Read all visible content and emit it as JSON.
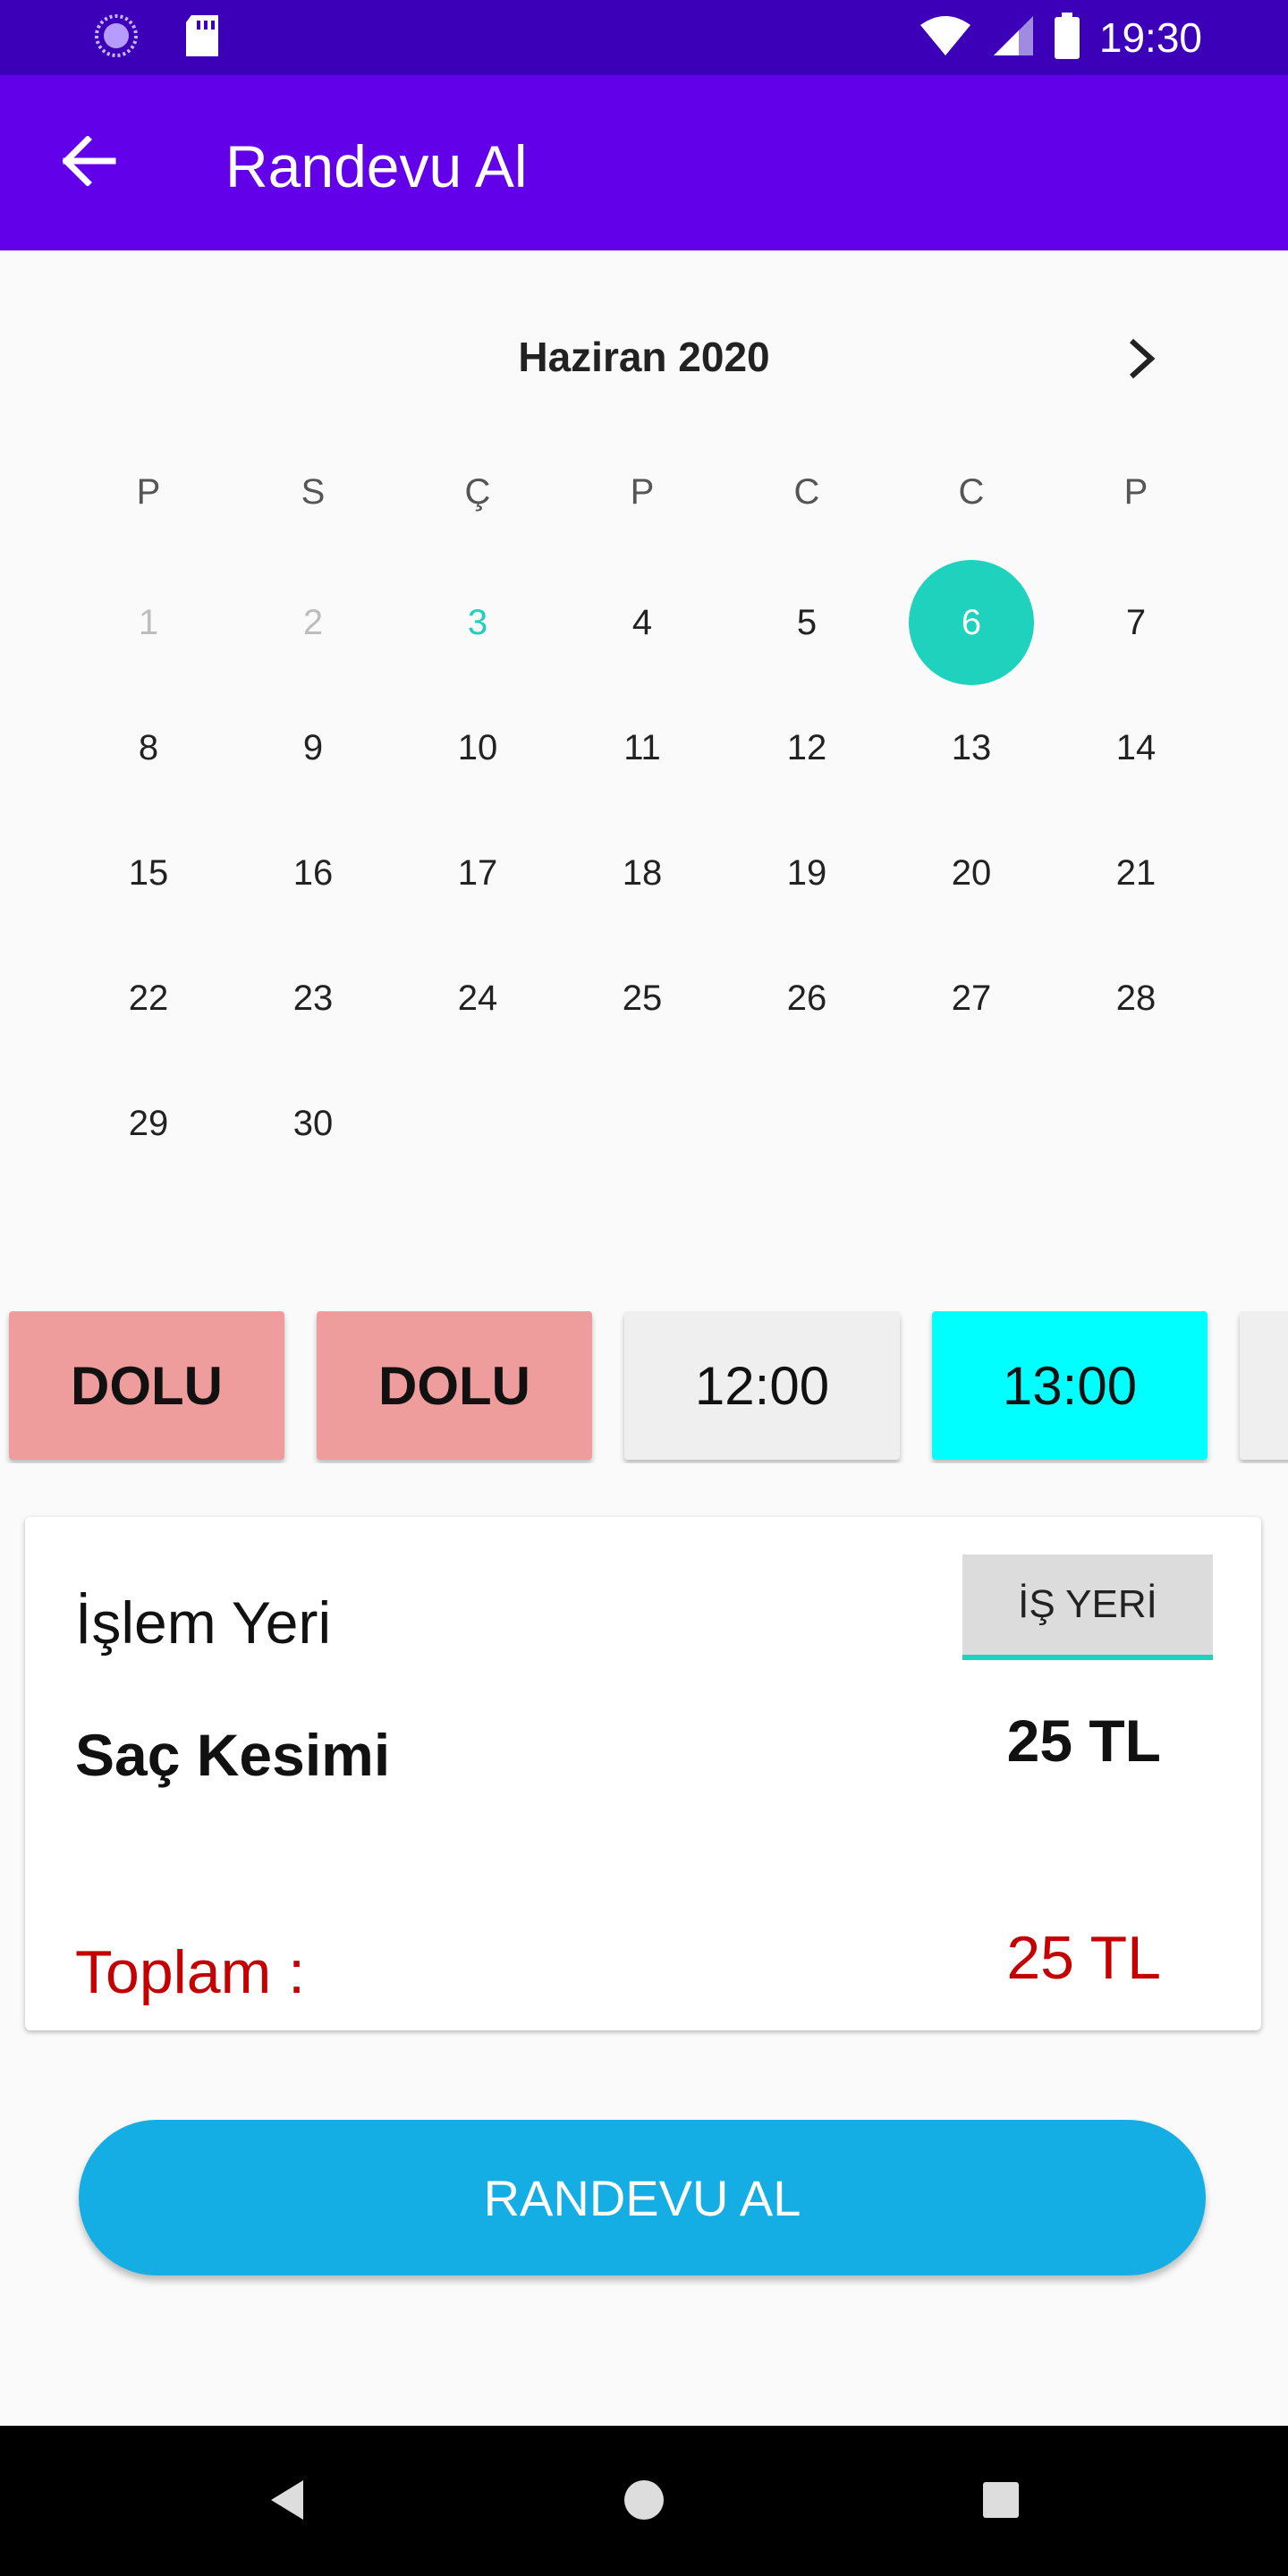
{
  "status_bar": {
    "time": "19:30",
    "left_icons": [
      "activity-icon",
      "sd-card-icon"
    ],
    "right_icons": [
      "wifi-icon",
      "signal-icon",
      "battery-icon"
    ]
  },
  "app_bar": {
    "title": "Randevu Al",
    "back_icon": "arrow-back-icon",
    "color": "#6200ea",
    "status_color": "#3b00b8"
  },
  "calendar": {
    "month": "Haziran 2020",
    "next_icon": "chevron-right-icon",
    "weekdays": [
      "P",
      "S",
      "Ç",
      "P",
      "C",
      "C",
      "P"
    ],
    "days": [
      {
        "n": "1",
        "state": "disabled"
      },
      {
        "n": "2",
        "state": "disabled"
      },
      {
        "n": "3",
        "state": "today"
      },
      {
        "n": "4"
      },
      {
        "n": "5"
      },
      {
        "n": "6",
        "state": "selected"
      },
      {
        "n": "7"
      },
      {
        "n": "8"
      },
      {
        "n": "9"
      },
      {
        "n": "10"
      },
      {
        "n": "11"
      },
      {
        "n": "12"
      },
      {
        "n": "13"
      },
      {
        "n": "14"
      },
      {
        "n": "15"
      },
      {
        "n": "16"
      },
      {
        "n": "17"
      },
      {
        "n": "18"
      },
      {
        "n": "19"
      },
      {
        "n": "20"
      },
      {
        "n": "21"
      },
      {
        "n": "22"
      },
      {
        "n": "23"
      },
      {
        "n": "24"
      },
      {
        "n": "25"
      },
      {
        "n": "26"
      },
      {
        "n": "27"
      },
      {
        "n": "28"
      },
      {
        "n": "29"
      },
      {
        "n": "30"
      }
    ],
    "accent_color": "#1fd2be"
  },
  "time_slots": [
    {
      "label": "DOLU",
      "state": "full"
    },
    {
      "label": "DOLU",
      "state": "full"
    },
    {
      "label": "12:00",
      "state": "free"
    },
    {
      "label": "13:00",
      "state": "selected"
    },
    {
      "label": "",
      "state": "free"
    }
  ],
  "summary": {
    "place_label": "İşlem Yeri",
    "place_button": "İŞ YERİ",
    "service_name": "Saç Kesimi",
    "service_price": "25 TL",
    "total_label": "Toplam :",
    "total_value": "25 TL",
    "total_color": "#c40000"
  },
  "action": {
    "label": "RANDEVU AL",
    "color": "#14aee5"
  },
  "nav_bar": {
    "icons": [
      "nav-back-icon",
      "nav-home-icon",
      "nav-recents-icon"
    ]
  }
}
